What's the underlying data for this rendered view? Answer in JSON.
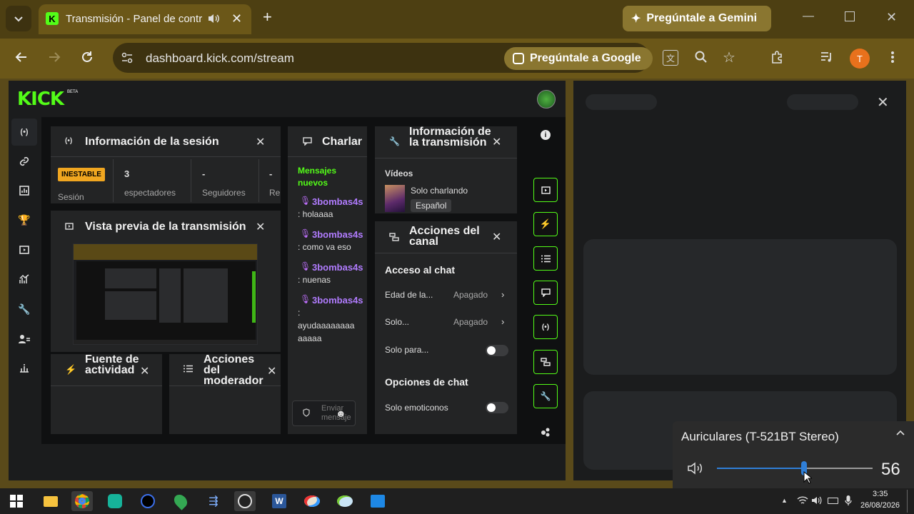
{
  "browser": {
    "tab_title": "Transmisión - Panel de control",
    "gemini_label": "Pregúntale a Gemini",
    "url": "dashboard.kick.com/stream",
    "google_label": "Pregúntale a Google",
    "avatar_letter": "T"
  },
  "kick": {
    "logo": "KICK",
    "logo_badge": "BETA",
    "session": {
      "title": "Información de la sesión",
      "status_badge": "INESTABLE",
      "status_label": "Sesión",
      "viewers_value": "3",
      "viewers_label": "espectadores",
      "followers_value": "-",
      "followers_label": "Seguidores",
      "extra_value": "-",
      "extra_label": "Re"
    },
    "preview": {
      "title": "Vista previa de la transmisión"
    },
    "activity": {
      "title": "Fuente de actividad"
    },
    "moderator": {
      "title": "Acciones del moderador"
    },
    "chat": {
      "title": "Charlar",
      "new_messages": "Mensajes nuevos",
      "messages": [
        {
          "user": "3bombas4s",
          "text": ": holaaaa"
        },
        {
          "user": "3bombas4s",
          "text": ": como va eso"
        },
        {
          "user": "3bombas4s",
          "text": ": nuenas"
        },
        {
          "user": "3bombas4s",
          "text": ":",
          "text2": "ayudaaaaaaaa",
          "text3": "aaaaa"
        }
      ],
      "send_placeholder": "Enviar mensaje"
    },
    "stream_info": {
      "title": "Información de la transmisión",
      "section": "Vídeos",
      "category": "Solo charlando",
      "language": "Español"
    },
    "channel_actions": {
      "title": "Acciones del canal",
      "chat_access": "Acceso al chat",
      "rows": [
        {
          "label": "Edad de la...",
          "value": "Apagado"
        },
        {
          "label": "Solo...",
          "value": "Apagado"
        }
      ],
      "solo_para": "Solo para...",
      "chat_options": "Opciones de chat",
      "emotes_only": "Solo emoticonos"
    }
  },
  "volume": {
    "device": "Auriculares (T-521BT Stereo)",
    "level": 56
  },
  "taskbar": {
    "time": "3:35",
    "date": "26/08/2026"
  },
  "colors": {
    "kick_green": "#53fc18",
    "chrome_frame": "#4d3f12",
    "chrome_toolbar": "#6b5718",
    "unstable_badge": "#f0a620",
    "volume_accent": "#2f7fd8"
  }
}
